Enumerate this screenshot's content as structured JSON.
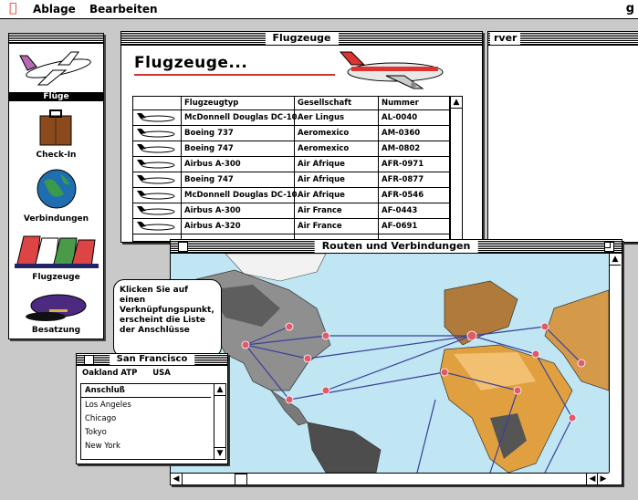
{
  "menubar": {
    "apple": "",
    "items": [
      "Ablage",
      "Bearbeiten"
    ],
    "right_fragment": "g"
  },
  "palette": {
    "tools": [
      {
        "label": "Flüge"
      },
      {
        "label": "Check-In"
      },
      {
        "label": "Verbindungen"
      },
      {
        "label": "Flugzeuge"
      },
      {
        "label": "Besatzung"
      }
    ]
  },
  "flugzeuge_window": {
    "title": "Flugzeuge",
    "heading": "Flugzeuge...",
    "columns": [
      "Flugzeugtyp",
      "Gesellschaft",
      "Nummer"
    ],
    "rows": [
      [
        "McDonnell Douglas DC-10",
        "Aer Lingus",
        "AL-0040"
      ],
      [
        "Boeing 737",
        "Aeromexico",
        "AM-0360"
      ],
      [
        "Boeing 747",
        "Aeromexico",
        "AM-0802"
      ],
      [
        "Airbus A-300",
        "Air Afrique",
        "AFR-0971"
      ],
      [
        "Boeing 747",
        "Air Afrique",
        "AFR-0877"
      ],
      [
        "McDonnell Douglas DC-10",
        "Air Afrique",
        "AFR-0546"
      ],
      [
        "Airbus A-300",
        "Air France",
        "AF-0443"
      ],
      [
        "Airbus A-320",
        "Air France",
        "AF-0691"
      ]
    ]
  },
  "server_window": {
    "title_fragment": "rver"
  },
  "routen_window": {
    "title": "Routen und Verbindungen"
  },
  "callout": {
    "text": "Klicken Sie auf einen Verknüpfungspunkt, erscheint die Liste der Anschlüsse"
  },
  "sf_window": {
    "title": "San Francisco",
    "airport": "Oakland ATP",
    "country": "USA",
    "list_header": "Anschluß",
    "items": [
      "Los Angeles",
      "Chicago",
      "Tokyo",
      "New York"
    ]
  }
}
